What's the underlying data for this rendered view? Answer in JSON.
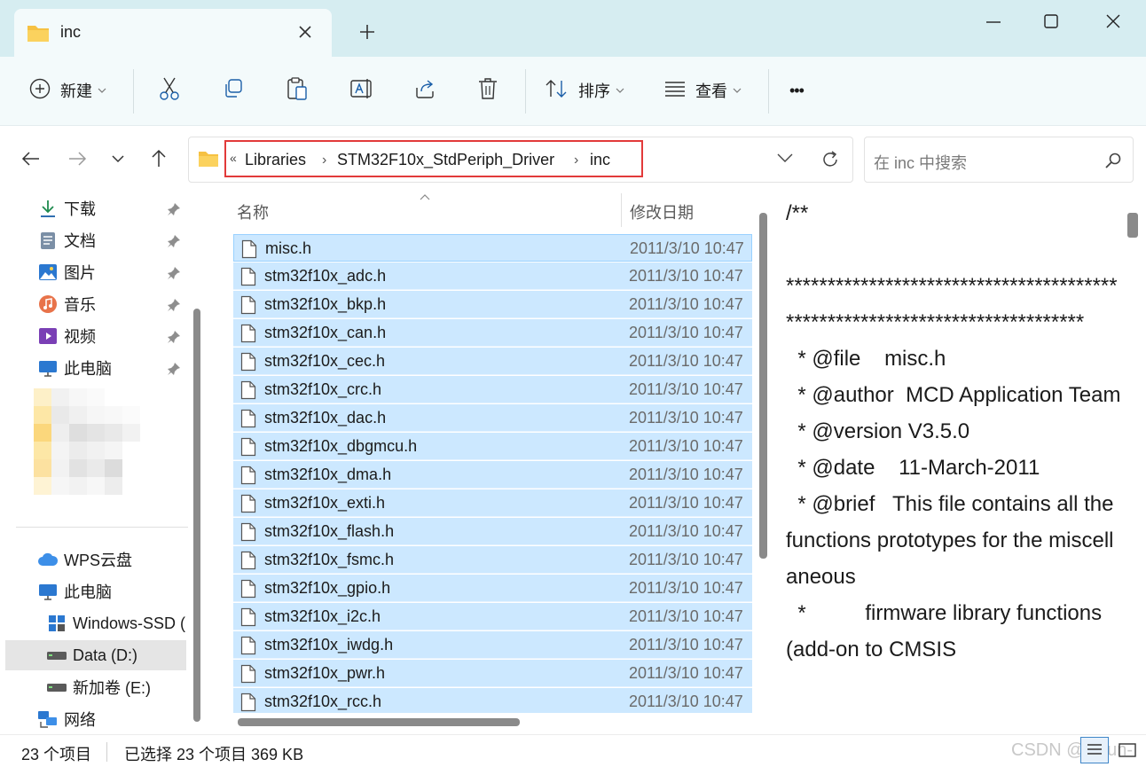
{
  "window": {
    "tab_title": "inc",
    "new_tab_glyph": "+",
    "folder_color": "#f6c142",
    "accent": "#0067c0"
  },
  "toolbar": {
    "new_label": "新建",
    "sort_label": "排序",
    "view_label": "查看",
    "more_glyph": "•••",
    "icons": [
      "plus-circle-icon",
      "cut-icon",
      "copy-icon",
      "paste-icon",
      "rename-icon",
      "share-icon",
      "delete-icon",
      "sort-icon",
      "view-icon",
      "more-icon"
    ]
  },
  "address": {
    "overflow": "«",
    "crumbs": [
      "Libraries",
      "STM32F10x_StdPeriph_Driver",
      "inc"
    ],
    "separator": "›",
    "highlight_color": "#e23a3a"
  },
  "search": {
    "placeholder": "在 inc 中搜索"
  },
  "sidebar": {
    "quick_access": [
      {
        "label": "下载",
        "icon": "download-icon"
      },
      {
        "label": "文档",
        "icon": "document-icon"
      },
      {
        "label": "图片",
        "icon": "picture-icon"
      },
      {
        "label": "音乐",
        "icon": "music-icon"
      },
      {
        "label": "视频",
        "icon": "video-icon"
      },
      {
        "label": "此电脑",
        "icon": "computer-icon"
      }
    ],
    "locations": [
      {
        "label": "WPS云盘",
        "icon": "cloud-icon"
      },
      {
        "label": "此电脑",
        "icon": "computer-icon"
      },
      {
        "label": "Windows-SSD (",
        "icon": "windows-drive-icon"
      },
      {
        "label": "Data (D:)",
        "icon": "drive-icon",
        "selected": true
      },
      {
        "label": "新加卷 (E:)",
        "icon": "drive-icon"
      },
      {
        "label": "网络",
        "icon": "network-icon"
      }
    ]
  },
  "files": {
    "col_name": "名称",
    "col_date": "修改日期",
    "rows": [
      {
        "name": "misc.h",
        "date": "2011/3/10 10:47"
      },
      {
        "name": "stm32f10x_adc.h",
        "date": "2011/3/10 10:47"
      },
      {
        "name": "stm32f10x_bkp.h",
        "date": "2011/3/10 10:47"
      },
      {
        "name": "stm32f10x_can.h",
        "date": "2011/3/10 10:47"
      },
      {
        "name": "stm32f10x_cec.h",
        "date": "2011/3/10 10:47"
      },
      {
        "name": "stm32f10x_crc.h",
        "date": "2011/3/10 10:47"
      },
      {
        "name": "stm32f10x_dac.h",
        "date": "2011/3/10 10:47"
      },
      {
        "name": "stm32f10x_dbgmcu.h",
        "date": "2011/3/10 10:47"
      },
      {
        "name": "stm32f10x_dma.h",
        "date": "2011/3/10 10:47"
      },
      {
        "name": "stm32f10x_exti.h",
        "date": "2011/3/10 10:47"
      },
      {
        "name": "stm32f10x_flash.h",
        "date": "2011/3/10 10:47"
      },
      {
        "name": "stm32f10x_fsmc.h",
        "date": "2011/3/10 10:47"
      },
      {
        "name": "stm32f10x_gpio.h",
        "date": "2011/3/10 10:47"
      },
      {
        "name": "stm32f10x_i2c.h",
        "date": "2011/3/10 10:47"
      },
      {
        "name": "stm32f10x_iwdg.h",
        "date": "2011/3/10 10:47"
      },
      {
        "name": "stm32f10x_pwr.h",
        "date": "2011/3/10 10:47"
      },
      {
        "name": "stm32f10x_rcc.h",
        "date": "2011/3/10 10:47"
      }
    ],
    "selected_color": "#cce8ff"
  },
  "preview": {
    "text": "/**\n\n****************************************************************************\n  * @file    misc.h\n  * @author  MCD Application Team\n  * @version V3.5.0\n  * @date    11-March-2011\n  * @brief   This file contains all the functions prototypes for the miscellaneous\n  *          firmware library functions (add-on to CMSIS"
  },
  "status": {
    "count": "23 个项目",
    "selection": "已选择 23 个项目  369 KB",
    "watermark": "CSDN @lecun-"
  }
}
